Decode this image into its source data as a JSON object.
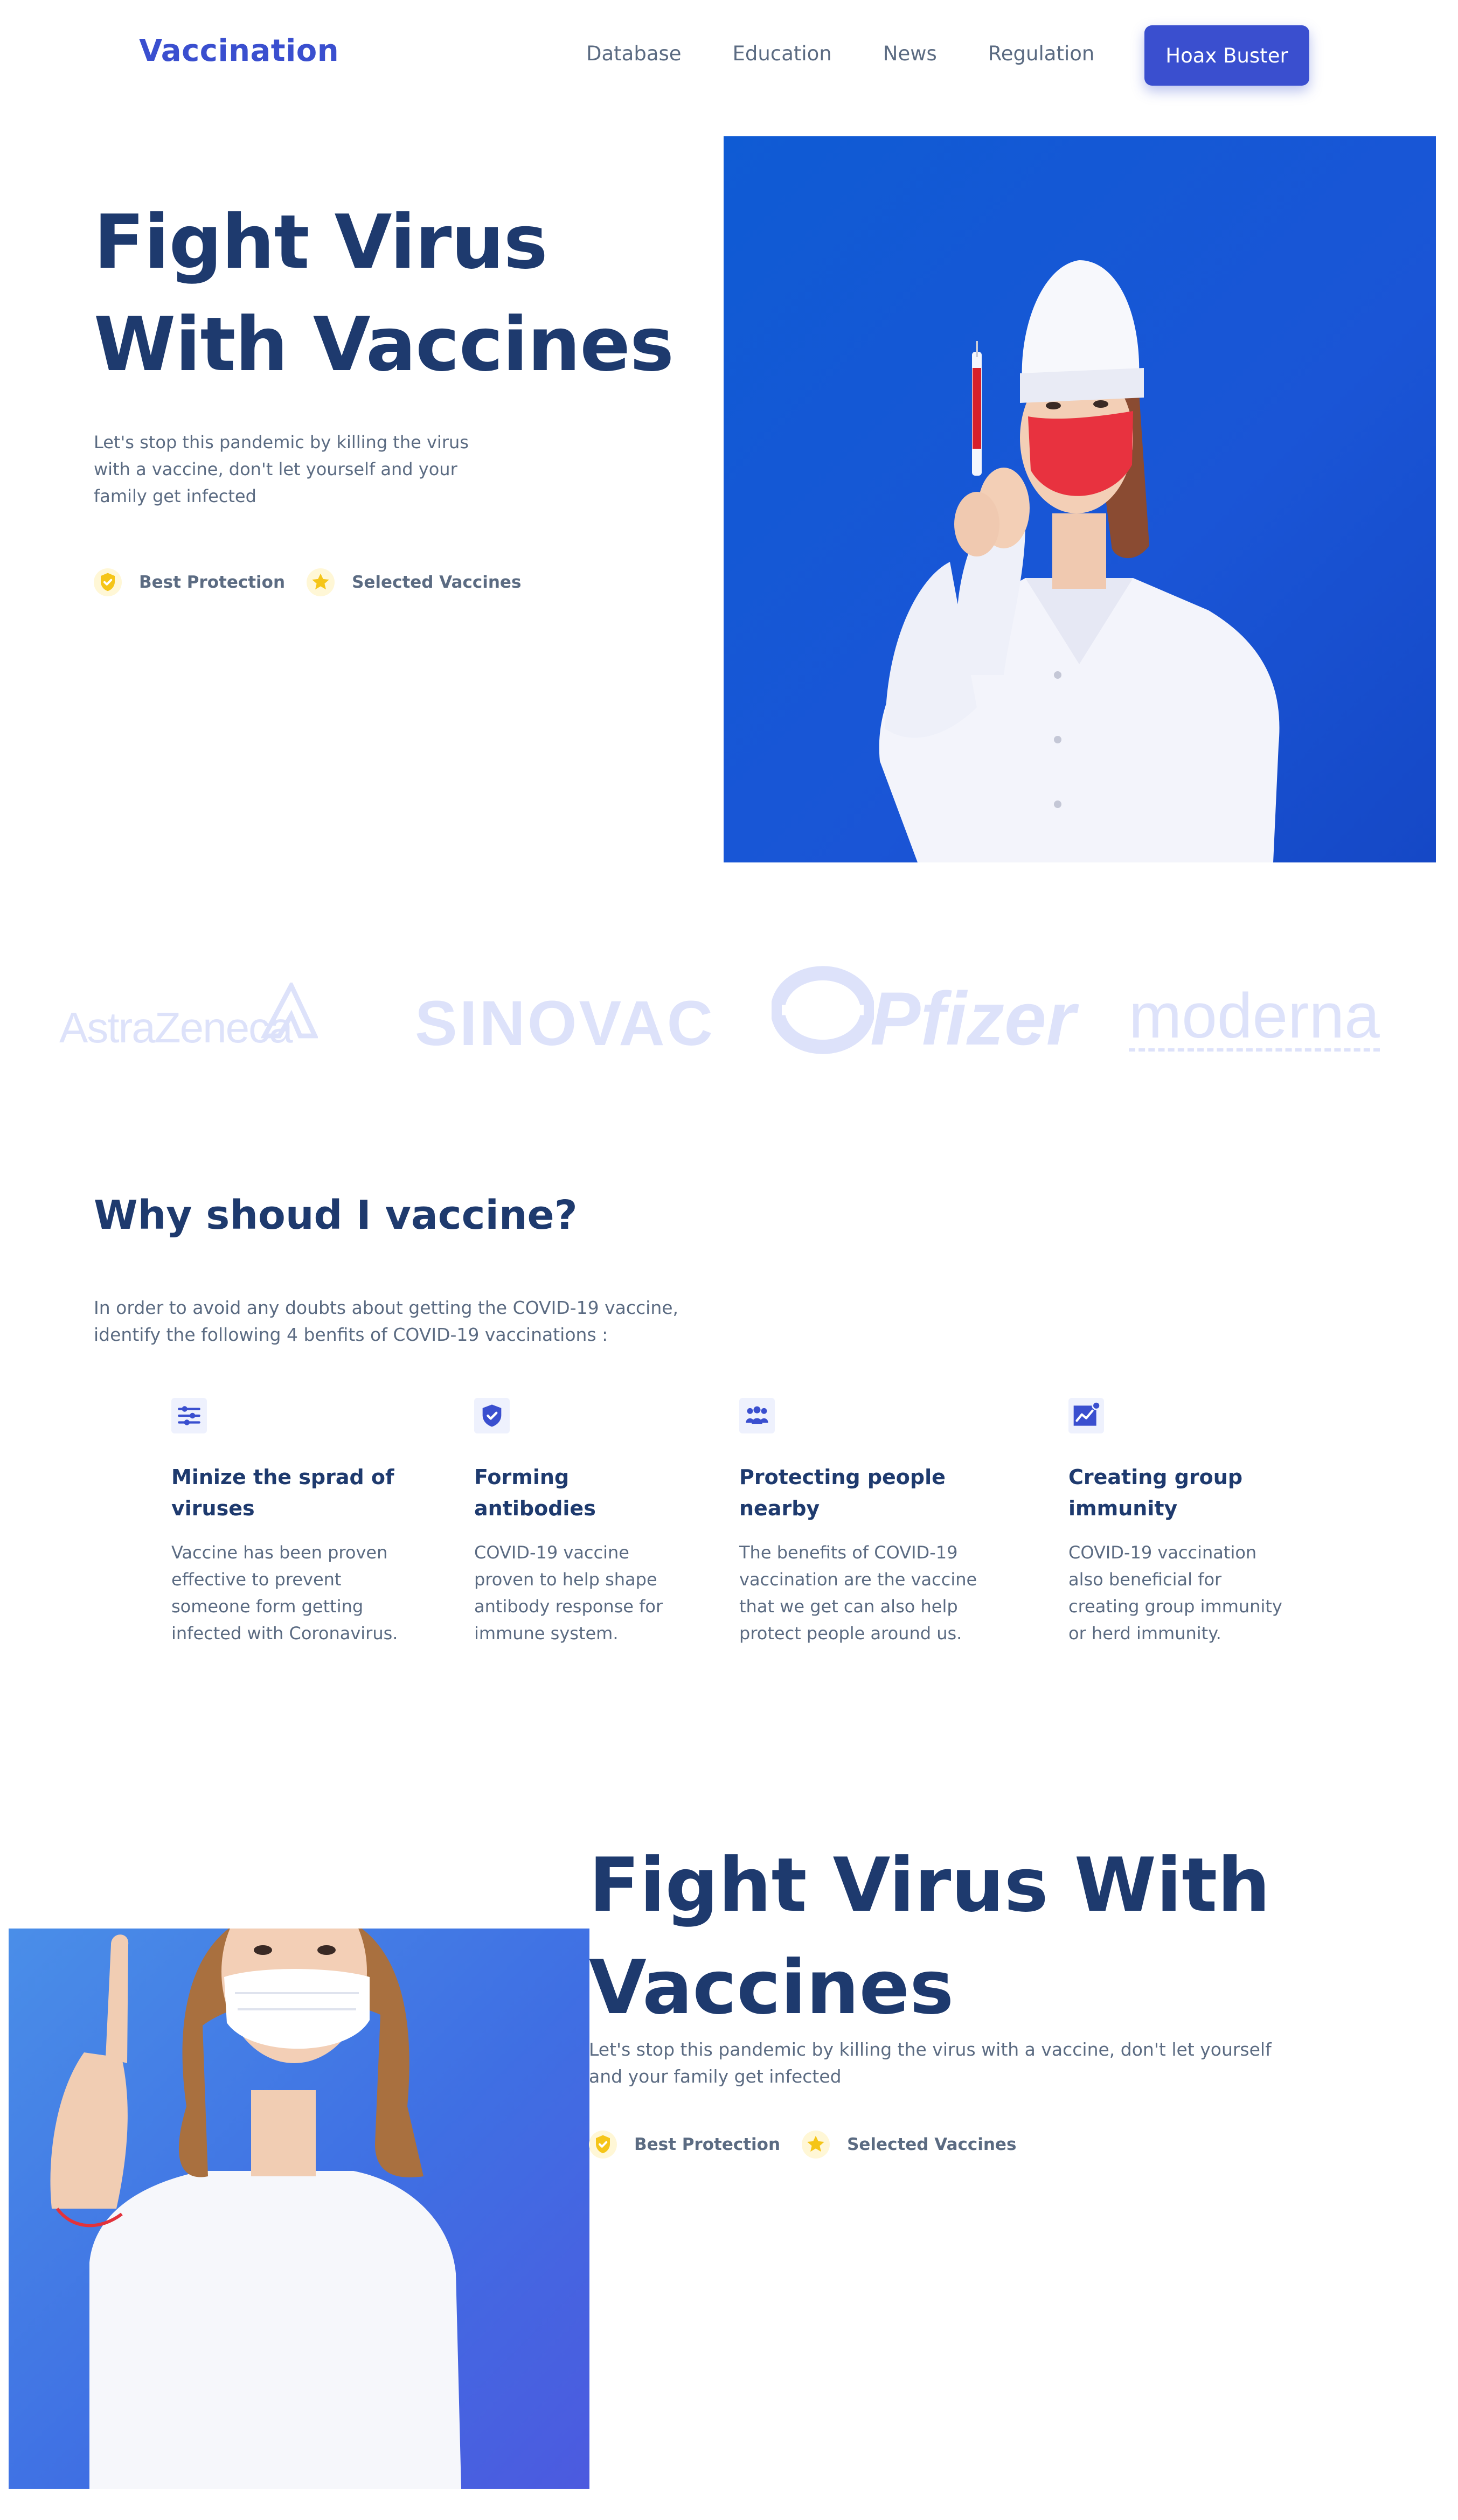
{
  "nav": {
    "logo": "Vaccination",
    "links": [
      "Database",
      "Education",
      "News",
      "Regulation"
    ],
    "cta": "Hoax Buster"
  },
  "hero": {
    "title_line1": "Fight Virus",
    "title_line2": "With Vaccines",
    "subtitle": "Let's stop this pandemic by killing the virus with a vaccine, don't let yourself and your family get infected",
    "badges": [
      {
        "icon": "shield-check-icon",
        "label": "Best Protection"
      },
      {
        "icon": "star-icon",
        "label": "Selected Vaccines"
      }
    ]
  },
  "brands": [
    "AstraZeneca",
    "SINOVAC",
    "Pfizer",
    "moderna"
  ],
  "why": {
    "title": "Why shoud I vaccine?",
    "subtitle": "In order to avoid any doubts about getting the COVID-19 vaccine, identify the following 4 benfits of COVID-19 vaccinations :",
    "features": [
      {
        "icon": "sliders-icon",
        "title": "Minize the sprad of viruses",
        "text": "Vaccine has been proven effective to prevent someone form getting infected with Coronavirus."
      },
      {
        "icon": "shield-check-icon",
        "title": "Forming antibodies",
        "text": "COVID-19 vaccine proven to help shape antibody response for immune system."
      },
      {
        "icon": "people-icon",
        "title": "Protecting people nearby",
        "text": "The benefits of COVID-19 vaccination are the vaccine that we get can also help protect people around us."
      },
      {
        "icon": "chart-up-icon",
        "title": "Creating group immunity",
        "text": "COVID-19 vaccination also beneficial for creating group immunity or herd immunity."
      }
    ]
  },
  "section2": {
    "title_line1": "Fight Virus With",
    "title_line2": "Vaccines",
    "subtitle": "Let's stop this pandemic by killing the virus with a vaccine, don't let yourself and your family get infected",
    "badges": [
      {
        "icon": "shield-check-icon",
        "label": "Best Protection"
      },
      {
        "icon": "star-icon",
        "label": "Selected Vaccines"
      }
    ]
  },
  "colors": {
    "primary": "#3a4fcf",
    "heading": "#1e3a6e",
    "body_text": "#5b6b82",
    "badge_yellow": "#f5c518",
    "brand_logo": "#dde2fa"
  }
}
